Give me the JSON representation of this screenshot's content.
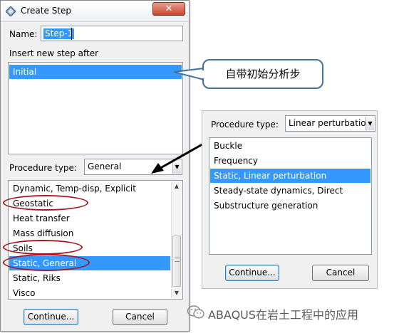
{
  "dialog": {
    "title": "Create Step",
    "close_glyph": "✕",
    "name_label": "Name:",
    "name_value": "Step-1",
    "insert_label": "Insert new step after",
    "steps": [
      "Initial"
    ],
    "procedure_label": "Procedure type:",
    "procedure_value": "General",
    "procedures": [
      "Dynamic, Temp-disp, Explicit",
      "Geostatic",
      "Heat transfer",
      "Mass diffusion",
      "Soils",
      "Static, General",
      "Static, Riks",
      "Visco"
    ],
    "selected_procedure": "Static, General",
    "continue_label": "Continue...",
    "cancel_label": "Cancel"
  },
  "callout": {
    "text": "自带初始分析步"
  },
  "panel2": {
    "procedure_label": "Procedure type:",
    "procedure_value": "Linear perturbation",
    "procedures": [
      "Buckle",
      "Frequency",
      "Static, Linear perturbation",
      "Steady-state dynamics, Direct",
      "Substructure generation"
    ],
    "selected_procedure": "Static, Linear perturbation",
    "continue_label": "Continue...",
    "cancel_label": "Cancel"
  },
  "watermark": {
    "text": "ABAQUS在岩土工程中的应用",
    "icon": "wechat-icon"
  },
  "colors": {
    "selection": "#3399ff",
    "annotation_red": "#a31920",
    "callout_border": "#41719c"
  }
}
